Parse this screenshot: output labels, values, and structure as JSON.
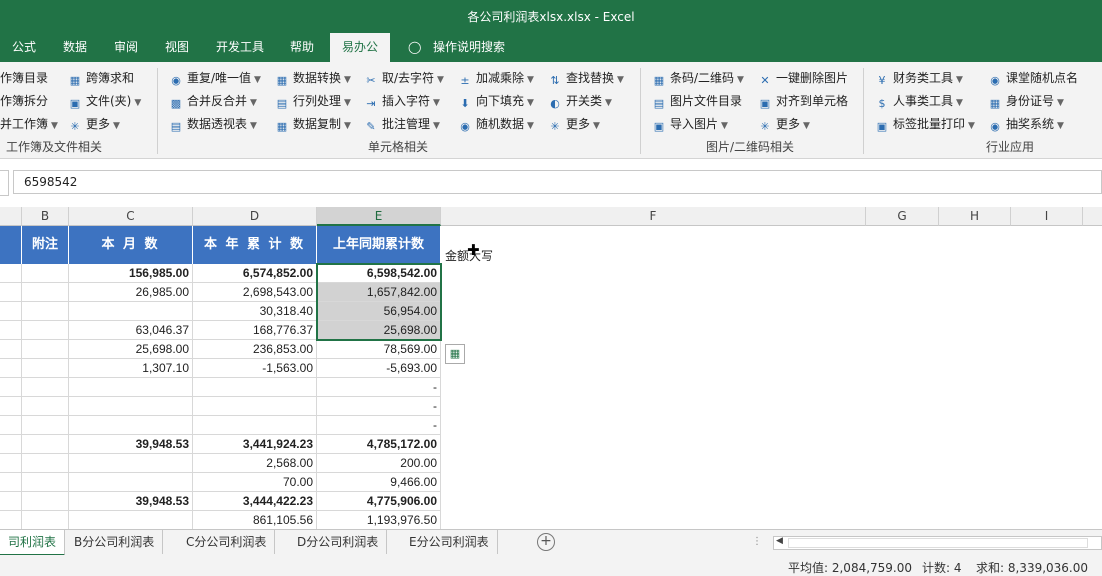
{
  "window": {
    "title": "各公司利润表xlsx.xlsx  -  Excel"
  },
  "menu_tabs": [
    "公式",
    "数据",
    "审阅",
    "视图",
    "开发工具",
    "帮助",
    "易办公"
  ],
  "tell_me": "操作说明搜索",
  "ribbon": {
    "g1": {
      "items": [
        "作簿目录",
        "作簿拆分",
        "并工作簿",
        "跨簿求和",
        "文件(夹)",
        "更多"
      ],
      "label": "工作簿及文件相关"
    },
    "g2": {
      "items": [
        "重复/唯一值",
        "合并反合并",
        "数据透视表",
        "数据转换",
        "行列处理",
        "数据复制",
        "取/去字符",
        "插入字符",
        "批注管理",
        "加减乘除",
        "向下填充",
        "随机数据",
        "查找替换",
        "开关类",
        "更多"
      ],
      "label": "单元格相关"
    },
    "g3": {
      "items": [
        "条码/二维码",
        "图片文件目录",
        "导入图片",
        "一键删除图片",
        "对齐到单元格",
        "更多"
      ],
      "label": "图片/二维码相关"
    },
    "g4": {
      "items": [
        "财务类工具",
        "人事类工具",
        "标签批量打印",
        "课堂随机点名",
        "身份证号",
        "抽奖系统"
      ],
      "label": "行业应用"
    }
  },
  "formula_bar": {
    "value": "6598542"
  },
  "columns": [
    "B",
    "C",
    "D",
    "E",
    "F",
    "G",
    "H",
    "I"
  ],
  "table": {
    "headers": [
      "附注",
      "本 月 数",
      "本 年 累 计 数",
      "上年同期累计数"
    ],
    "rows": [
      [
        "156,985.00",
        "6,574,852.00",
        "6,598,542.00"
      ],
      [
        "26,985.00",
        "2,698,543.00",
        "1,657,842.00"
      ],
      [
        "",
        "30,318.40",
        "56,954.00"
      ],
      [
        "63,046.37",
        "168,776.37",
        "25,698.00"
      ],
      [
        "25,698.00",
        "236,853.00",
        "78,569.00"
      ],
      [
        "1,307.10",
        "-1,563.00",
        "-5,693.00"
      ],
      [
        "",
        "",
        "-"
      ],
      [
        "",
        "",
        "-"
      ],
      [
        "",
        "",
        "-"
      ],
      [
        "39,948.53",
        "3,441,924.23",
        "4,785,172.00"
      ],
      [
        "",
        "2,568.00",
        "200.00"
      ],
      [
        "",
        "70.00",
        "9,466.00"
      ],
      [
        "39,948.53",
        "3,444,422.23",
        "4,775,906.00"
      ],
      [
        "",
        "861,105.56",
        "1,193,976.50"
      ]
    ]
  },
  "f_note": "金额大写",
  "sheet_tabs": [
    "司利润表",
    "B分公司利润表",
    "C分公司利润表",
    "D分公司利润表",
    "E分公司利润表"
  ],
  "status": {
    "avg": "平均值: 2,084,759.00",
    "count": "计数: 4",
    "sum": "求和: 8,339,036.00"
  }
}
